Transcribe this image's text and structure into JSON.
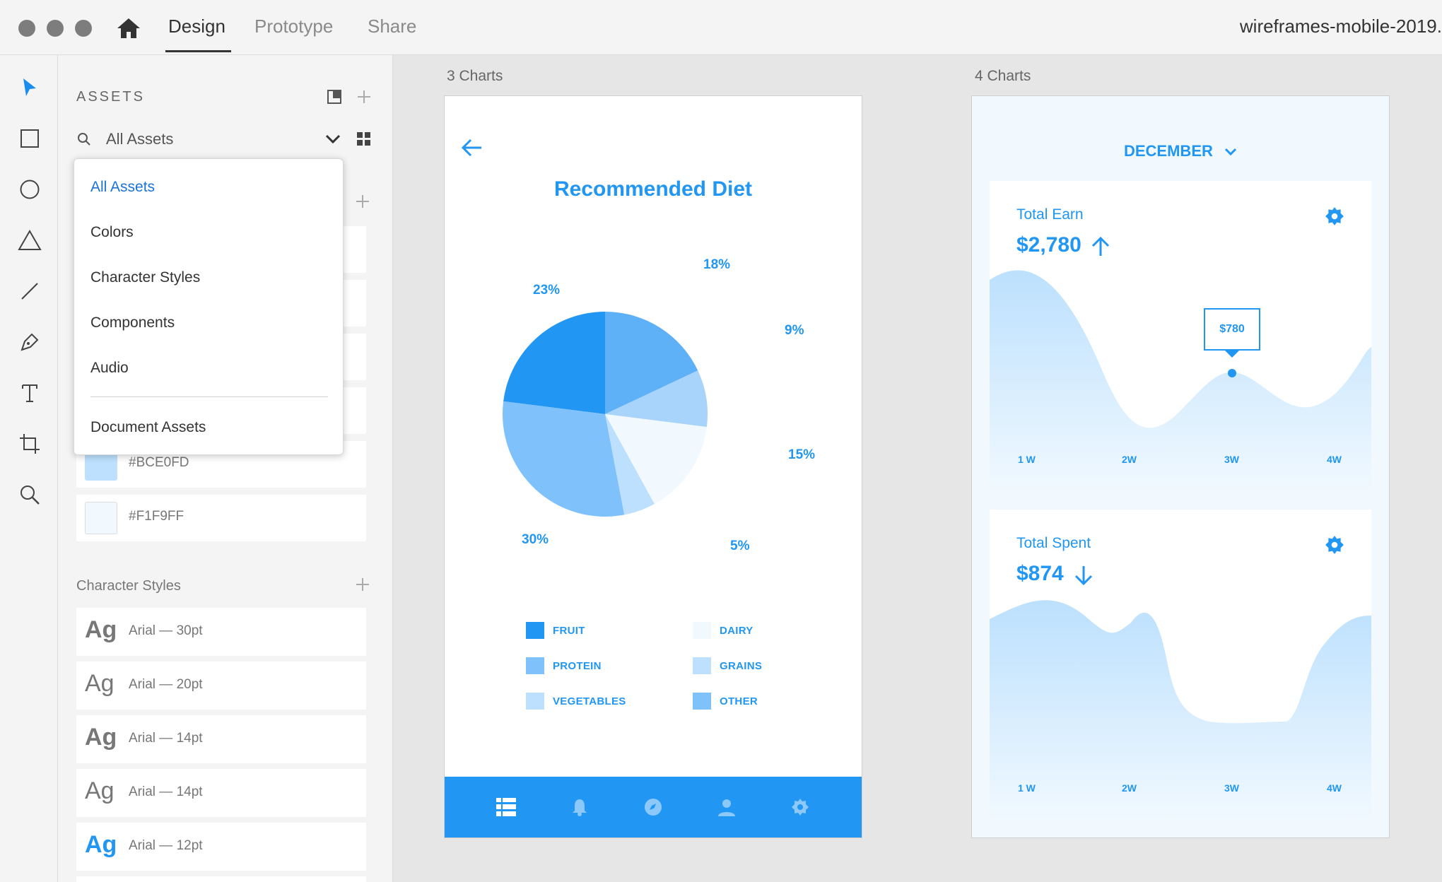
{
  "titlebar": {
    "tabs": [
      "Design",
      "Prototype",
      "Share"
    ],
    "active_tab": "Design",
    "document_title": "wireframes-mobile-2019."
  },
  "tools": [
    "select-arrow-icon",
    "rectangle-icon",
    "ellipse-icon",
    "triangle-icon",
    "line-icon",
    "pen-icon",
    "text-icon",
    "artboard-icon",
    "zoom-icon"
  ],
  "assets_panel": {
    "title": "ASSETS",
    "filter_value": "All Assets",
    "dropdown": {
      "items": [
        "All Assets",
        "Colors",
        "Character Styles",
        "Components",
        "Audio"
      ],
      "footer_item": "Document Assets",
      "selected": "All Assets"
    },
    "colors": [
      {
        "label": "#BCE0FD",
        "hex": "#BCE0FD"
      },
      {
        "label": "#F1F9FF",
        "hex": "#F1F9FF"
      }
    ],
    "character_styles_label": "Character Styles",
    "character_styles": [
      {
        "sample": "Ag",
        "label": "Arial — 30pt",
        "weight": "bold",
        "color": "#777777"
      },
      {
        "sample": "Ag",
        "label": "Arial — 20pt",
        "weight": "normal",
        "color": "#777777"
      },
      {
        "sample": "Ag",
        "label": "Arial — 14pt",
        "weight": "bold",
        "color": "#777777"
      },
      {
        "sample": "Ag",
        "label": "Arial — 14pt",
        "weight": "normal",
        "color": "#777777"
      },
      {
        "sample": "Ag",
        "label": "Arial — 12pt",
        "weight": "bold",
        "color": "#2196F3"
      }
    ]
  },
  "artboard1": {
    "label": "3 Charts",
    "title": "Recommended Diet",
    "slices": [
      {
        "name": "FRUIT",
        "pct": "23%",
        "value": 23,
        "color": "#2196F3"
      },
      {
        "name": "OTHER",
        "pct": "18%",
        "value": 18,
        "color": "#5EB0F7"
      },
      {
        "name": "GRAINS",
        "pct": "9%",
        "value": 9,
        "color": "#A8D4FB"
      },
      {
        "name": "DAIRY",
        "pct": "15%",
        "value": 15,
        "color": "#F1F9FF"
      },
      {
        "name": "VEGETABLES",
        "pct": "5%",
        "value": 5,
        "color": "#BCE0FD"
      },
      {
        "name": "PROTEIN",
        "pct": "30%",
        "value": 30,
        "color": "#7FC1FA"
      }
    ],
    "legend": [
      {
        "label": "FRUIT",
        "color": "#2196F3"
      },
      {
        "label": "DAIRY",
        "color": "#F1F9FF"
      },
      {
        "label": "PROTEIN",
        "color": "#7FC1FA"
      },
      {
        "label": "GRAINS",
        "color": "#BCE0FD"
      },
      {
        "label": "VEGETABLES",
        "color": "#BCE0FD"
      },
      {
        "label": "OTHER",
        "color": "#7FC1FA"
      }
    ],
    "nav_icons": [
      "list-icon",
      "bell-icon",
      "compass-icon",
      "user-icon",
      "gear-icon"
    ]
  },
  "artboard2": {
    "label": "4 Charts",
    "month": "DECEMBER",
    "earn": {
      "title": "Total Earn",
      "amount": "$2,780",
      "trend": "up",
      "tooltip": "$780",
      "weeks": [
        "1 W",
        "2W",
        "3W",
        "4W"
      ]
    },
    "spent": {
      "title": "Total Spent",
      "amount": "$874",
      "trend": "down",
      "weeks": [
        "1 W",
        "2W",
        "3W",
        "4W"
      ]
    }
  },
  "colors": {
    "accent": "#2196F3"
  }
}
